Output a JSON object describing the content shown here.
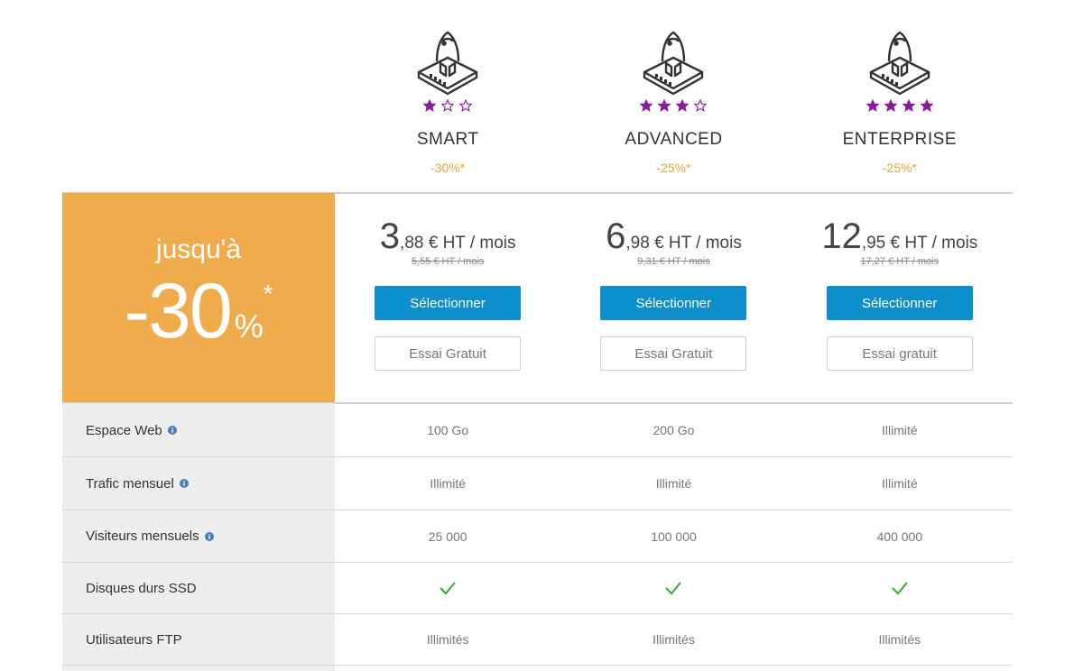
{
  "colors": {
    "accent_orange": "#efab4c",
    "discount_orange": "#e8a23d",
    "button_blue": "#0d8fcc",
    "star_purple": "#8b1a9c",
    "check_green": "#3aa63a"
  },
  "plans": [
    {
      "name": "SMART",
      "rating": 1,
      "max_rating": 3,
      "discount": "-30%*",
      "price_int": "3",
      "price_rest": ",88 € HT / mois",
      "price_old": "5,55 € HT / mois",
      "select_label": "Sélectionner",
      "trial_label": "Essai Gratuit"
    },
    {
      "name": "ADVANCED",
      "rating": 3,
      "max_rating": 4,
      "discount": "-25%*",
      "price_int": "6",
      "price_rest": ",98 € HT / mois",
      "price_old": "9,31 € HT / mois",
      "select_label": "Sélectionner",
      "trial_label": "Essai Gratuit"
    },
    {
      "name": "ENTERPRISE",
      "rating": 4,
      "max_rating": 4,
      "discount": "-25%*",
      "price_int": "12",
      "price_rest": ",95 € HT / mois",
      "price_old": "17,27 € HT / mois",
      "select_label": "Sélectionner",
      "trial_label": "Essai gratuit"
    }
  ],
  "promo": {
    "small": "jusqu'à",
    "big": "-30",
    "pct": "%",
    "star": "*"
  },
  "features": [
    {
      "label": "Espace Web",
      "info": true,
      "values": [
        "100 Go",
        "200 Go",
        "Illimité"
      ]
    },
    {
      "label": "Trafic mensuel",
      "info": true,
      "values": [
        "Illimité",
        "Illimité",
        "Illimité"
      ]
    },
    {
      "label": "Visiteurs mensuels",
      "info": true,
      "values": [
        "25 000",
        "100 000",
        "400 000"
      ]
    },
    {
      "label": "Disques durs SSD",
      "info": false,
      "values": [
        "check",
        "check",
        "check"
      ]
    },
    {
      "label": "Utilisateurs FTP",
      "info": false,
      "values": [
        "Illimités",
        "Illimités",
        "Illimités"
      ]
    }
  ]
}
